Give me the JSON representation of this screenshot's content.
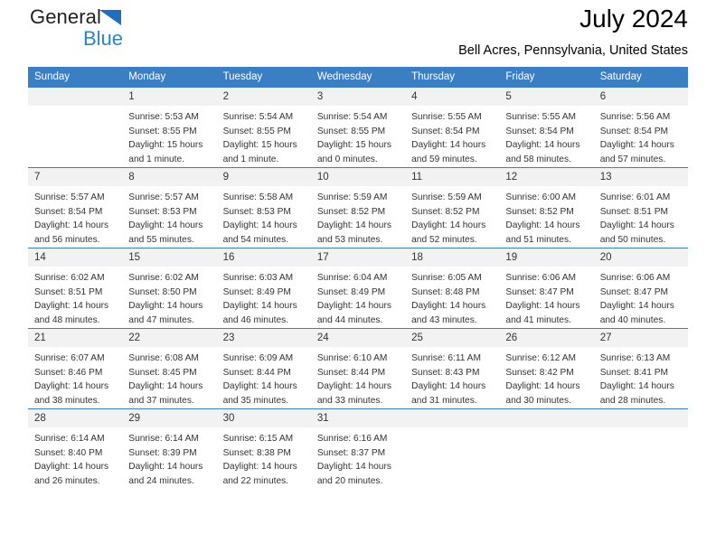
{
  "brand": {
    "name_part1": "General",
    "name_part2": "Blue",
    "triangle_color": "#1f6fc0",
    "blue_color": "#2585d3"
  },
  "header": {
    "month_title": "July 2024",
    "location": "Bell Acres, Pennsylvania, United States"
  },
  "calendar": {
    "header_color": "#3a7fc4",
    "daynum_bg": "#f2f2f2",
    "weekdays": [
      "Sunday",
      "Monday",
      "Tuesday",
      "Wednesday",
      "Thursday",
      "Friday",
      "Saturday"
    ],
    "labels": {
      "sunrise": "Sunrise:",
      "sunset": "Sunset:",
      "daylight": "Daylight:"
    },
    "weeks": [
      [
        {
          "day": "",
          "sunrise": "",
          "sunset": "",
          "daylight_line1": "",
          "daylight_line2": "",
          "empty": true
        },
        {
          "day": "1",
          "sunrise": "Sunrise: 5:53 AM",
          "sunset": "Sunset: 8:55 PM",
          "daylight_line1": "Daylight: 15 hours",
          "daylight_line2": "and 1 minute."
        },
        {
          "day": "2",
          "sunrise": "Sunrise: 5:54 AM",
          "sunset": "Sunset: 8:55 PM",
          "daylight_line1": "Daylight: 15 hours",
          "daylight_line2": "and 1 minute."
        },
        {
          "day": "3",
          "sunrise": "Sunrise: 5:54 AM",
          "sunset": "Sunset: 8:55 PM",
          "daylight_line1": "Daylight: 15 hours",
          "daylight_line2": "and 0 minutes."
        },
        {
          "day": "4",
          "sunrise": "Sunrise: 5:55 AM",
          "sunset": "Sunset: 8:54 PM",
          "daylight_line1": "Daylight: 14 hours",
          "daylight_line2": "and 59 minutes."
        },
        {
          "day": "5",
          "sunrise": "Sunrise: 5:55 AM",
          "sunset": "Sunset: 8:54 PM",
          "daylight_line1": "Daylight: 14 hours",
          "daylight_line2": "and 58 minutes."
        },
        {
          "day": "6",
          "sunrise": "Sunrise: 5:56 AM",
          "sunset": "Sunset: 8:54 PM",
          "daylight_line1": "Daylight: 14 hours",
          "daylight_line2": "and 57 minutes."
        }
      ],
      [
        {
          "day": "7",
          "sunrise": "Sunrise: 5:57 AM",
          "sunset": "Sunset: 8:54 PM",
          "daylight_line1": "Daylight: 14 hours",
          "daylight_line2": "and 56 minutes."
        },
        {
          "day": "8",
          "sunrise": "Sunrise: 5:57 AM",
          "sunset": "Sunset: 8:53 PM",
          "daylight_line1": "Daylight: 14 hours",
          "daylight_line2": "and 55 minutes."
        },
        {
          "day": "9",
          "sunrise": "Sunrise: 5:58 AM",
          "sunset": "Sunset: 8:53 PM",
          "daylight_line1": "Daylight: 14 hours",
          "daylight_line2": "and 54 minutes."
        },
        {
          "day": "10",
          "sunrise": "Sunrise: 5:59 AM",
          "sunset": "Sunset: 8:52 PM",
          "daylight_line1": "Daylight: 14 hours",
          "daylight_line2": "and 53 minutes."
        },
        {
          "day": "11",
          "sunrise": "Sunrise: 5:59 AM",
          "sunset": "Sunset: 8:52 PM",
          "daylight_line1": "Daylight: 14 hours",
          "daylight_line2": "and 52 minutes."
        },
        {
          "day": "12",
          "sunrise": "Sunrise: 6:00 AM",
          "sunset": "Sunset: 8:52 PM",
          "daylight_line1": "Daylight: 14 hours",
          "daylight_line2": "and 51 minutes."
        },
        {
          "day": "13",
          "sunrise": "Sunrise: 6:01 AM",
          "sunset": "Sunset: 8:51 PM",
          "daylight_line1": "Daylight: 14 hours",
          "daylight_line2": "and 50 minutes."
        }
      ],
      [
        {
          "day": "14",
          "sunrise": "Sunrise: 6:02 AM",
          "sunset": "Sunset: 8:51 PM",
          "daylight_line1": "Daylight: 14 hours",
          "daylight_line2": "and 48 minutes."
        },
        {
          "day": "15",
          "sunrise": "Sunrise: 6:02 AM",
          "sunset": "Sunset: 8:50 PM",
          "daylight_line1": "Daylight: 14 hours",
          "daylight_line2": "and 47 minutes."
        },
        {
          "day": "16",
          "sunrise": "Sunrise: 6:03 AM",
          "sunset": "Sunset: 8:49 PM",
          "daylight_line1": "Daylight: 14 hours",
          "daylight_line2": "and 46 minutes."
        },
        {
          "day": "17",
          "sunrise": "Sunrise: 6:04 AM",
          "sunset": "Sunset: 8:49 PM",
          "daylight_line1": "Daylight: 14 hours",
          "daylight_line2": "and 44 minutes."
        },
        {
          "day": "18",
          "sunrise": "Sunrise: 6:05 AM",
          "sunset": "Sunset: 8:48 PM",
          "daylight_line1": "Daylight: 14 hours",
          "daylight_line2": "and 43 minutes."
        },
        {
          "day": "19",
          "sunrise": "Sunrise: 6:06 AM",
          "sunset": "Sunset: 8:47 PM",
          "daylight_line1": "Daylight: 14 hours",
          "daylight_line2": "and 41 minutes."
        },
        {
          "day": "20",
          "sunrise": "Sunrise: 6:06 AM",
          "sunset": "Sunset: 8:47 PM",
          "daylight_line1": "Daylight: 14 hours",
          "daylight_line2": "and 40 minutes."
        }
      ],
      [
        {
          "day": "21",
          "sunrise": "Sunrise: 6:07 AM",
          "sunset": "Sunset: 8:46 PM",
          "daylight_line1": "Daylight: 14 hours",
          "daylight_line2": "and 38 minutes."
        },
        {
          "day": "22",
          "sunrise": "Sunrise: 6:08 AM",
          "sunset": "Sunset: 8:45 PM",
          "daylight_line1": "Daylight: 14 hours",
          "daylight_line2": "and 37 minutes."
        },
        {
          "day": "23",
          "sunrise": "Sunrise: 6:09 AM",
          "sunset": "Sunset: 8:44 PM",
          "daylight_line1": "Daylight: 14 hours",
          "daylight_line2": "and 35 minutes."
        },
        {
          "day": "24",
          "sunrise": "Sunrise: 6:10 AM",
          "sunset": "Sunset: 8:44 PM",
          "daylight_line1": "Daylight: 14 hours",
          "daylight_line2": "and 33 minutes."
        },
        {
          "day": "25",
          "sunrise": "Sunrise: 6:11 AM",
          "sunset": "Sunset: 8:43 PM",
          "daylight_line1": "Daylight: 14 hours",
          "daylight_line2": "and 31 minutes."
        },
        {
          "day": "26",
          "sunrise": "Sunrise: 6:12 AM",
          "sunset": "Sunset: 8:42 PM",
          "daylight_line1": "Daylight: 14 hours",
          "daylight_line2": "and 30 minutes."
        },
        {
          "day": "27",
          "sunrise": "Sunrise: 6:13 AM",
          "sunset": "Sunset: 8:41 PM",
          "daylight_line1": "Daylight: 14 hours",
          "daylight_line2": "and 28 minutes."
        }
      ],
      [
        {
          "day": "28",
          "sunrise": "Sunrise: 6:14 AM",
          "sunset": "Sunset: 8:40 PM",
          "daylight_line1": "Daylight: 14 hours",
          "daylight_line2": "and 26 minutes."
        },
        {
          "day": "29",
          "sunrise": "Sunrise: 6:14 AM",
          "sunset": "Sunset: 8:39 PM",
          "daylight_line1": "Daylight: 14 hours",
          "daylight_line2": "and 24 minutes."
        },
        {
          "day": "30",
          "sunrise": "Sunrise: 6:15 AM",
          "sunset": "Sunset: 8:38 PM",
          "daylight_line1": "Daylight: 14 hours",
          "daylight_line2": "and 22 minutes."
        },
        {
          "day": "31",
          "sunrise": "Sunrise: 6:16 AM",
          "sunset": "Sunset: 8:37 PM",
          "daylight_line1": "Daylight: 14 hours",
          "daylight_line2": "and 20 minutes."
        },
        {
          "day": "",
          "sunrise": "",
          "sunset": "",
          "daylight_line1": "",
          "daylight_line2": "",
          "empty": true
        },
        {
          "day": "",
          "sunrise": "",
          "sunset": "",
          "daylight_line1": "",
          "daylight_line2": "",
          "empty": true
        },
        {
          "day": "",
          "sunrise": "",
          "sunset": "",
          "daylight_line1": "",
          "daylight_line2": "",
          "empty": true
        }
      ]
    ]
  }
}
